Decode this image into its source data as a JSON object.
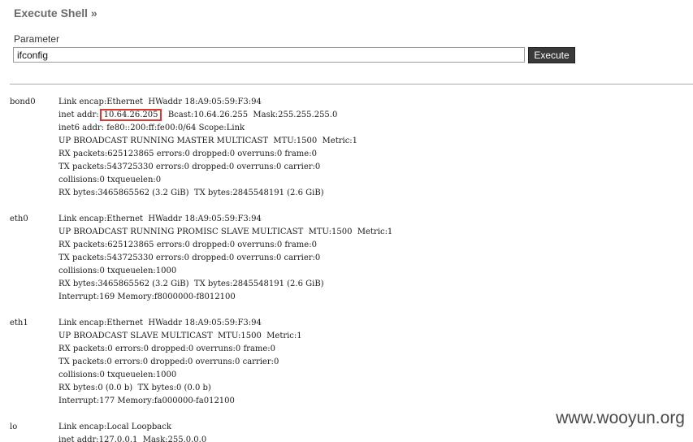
{
  "header": {
    "title": "Execute Shell »"
  },
  "form": {
    "param_label": "Parameter",
    "param_value": "ifconfig",
    "execute_label": "Execute"
  },
  "output": {
    "interfaces": [
      {
        "name": "bond0",
        "lines": [
          "Link encap:Ethernet  HWaddr 18:A9:05:59:F3:94",
          "inet addr:10.64.26.205  Bcast:10.64.26.255  Mask:255.255.255.0",
          "inet6 addr: fe80::200:ff:fe00:0/64 Scope:Link",
          "UP BROADCAST RUNNING MASTER MULTICAST  MTU:1500  Metric:1",
          "RX packets:625123865 errors:0 dropped:0 overruns:0 frame:0",
          "TX packets:543725330 errors:0 dropped:0 overruns:0 carrier:0",
          "collisions:0 txqueuelen:0",
          "RX bytes:3465865562 (3.2 GiB)  TX bytes:2845548191 (2.6 GiB)"
        ]
      },
      {
        "name": "eth0",
        "lines": [
          "Link encap:Ethernet  HWaddr 18:A9:05:59:F3:94",
          "UP BROADCAST RUNNING PROMISC SLAVE MULTICAST  MTU:1500  Metric:1",
          "RX packets:625123865 errors:0 dropped:0 overruns:0 frame:0",
          "TX packets:543725330 errors:0 dropped:0 overruns:0 carrier:0",
          "collisions:0 txqueuelen:1000",
          "RX bytes:3465865562 (3.2 GiB)  TX bytes:2845548191 (2.6 GiB)",
          "Interrupt:169 Memory:f8000000-f8012100"
        ]
      },
      {
        "name": "eth1",
        "lines": [
          "Link encap:Ethernet  HWaddr 18:A9:05:59:F3:94",
          "UP BROADCAST SLAVE MULTICAST  MTU:1500  Metric:1",
          "RX packets:0 errors:0 dropped:0 overruns:0 frame:0",
          "TX packets:0 errors:0 dropped:0 overruns:0 carrier:0",
          "collisions:0 txqueuelen:1000",
          "RX bytes:0 (0.0 b)  TX bytes:0 (0.0 b)",
          "Interrupt:177 Memory:fa000000-fa012100"
        ]
      },
      {
        "name": "lo",
        "lines": [
          "Link encap:Local Loopback",
          "inet addr:127.0.0.1  Mask:255.0.0.0"
        ]
      }
    ],
    "highlight": {
      "text": "10.64.26.205",
      "color": "#e0362c"
    }
  },
  "watermark": "www.wooyun.org"
}
